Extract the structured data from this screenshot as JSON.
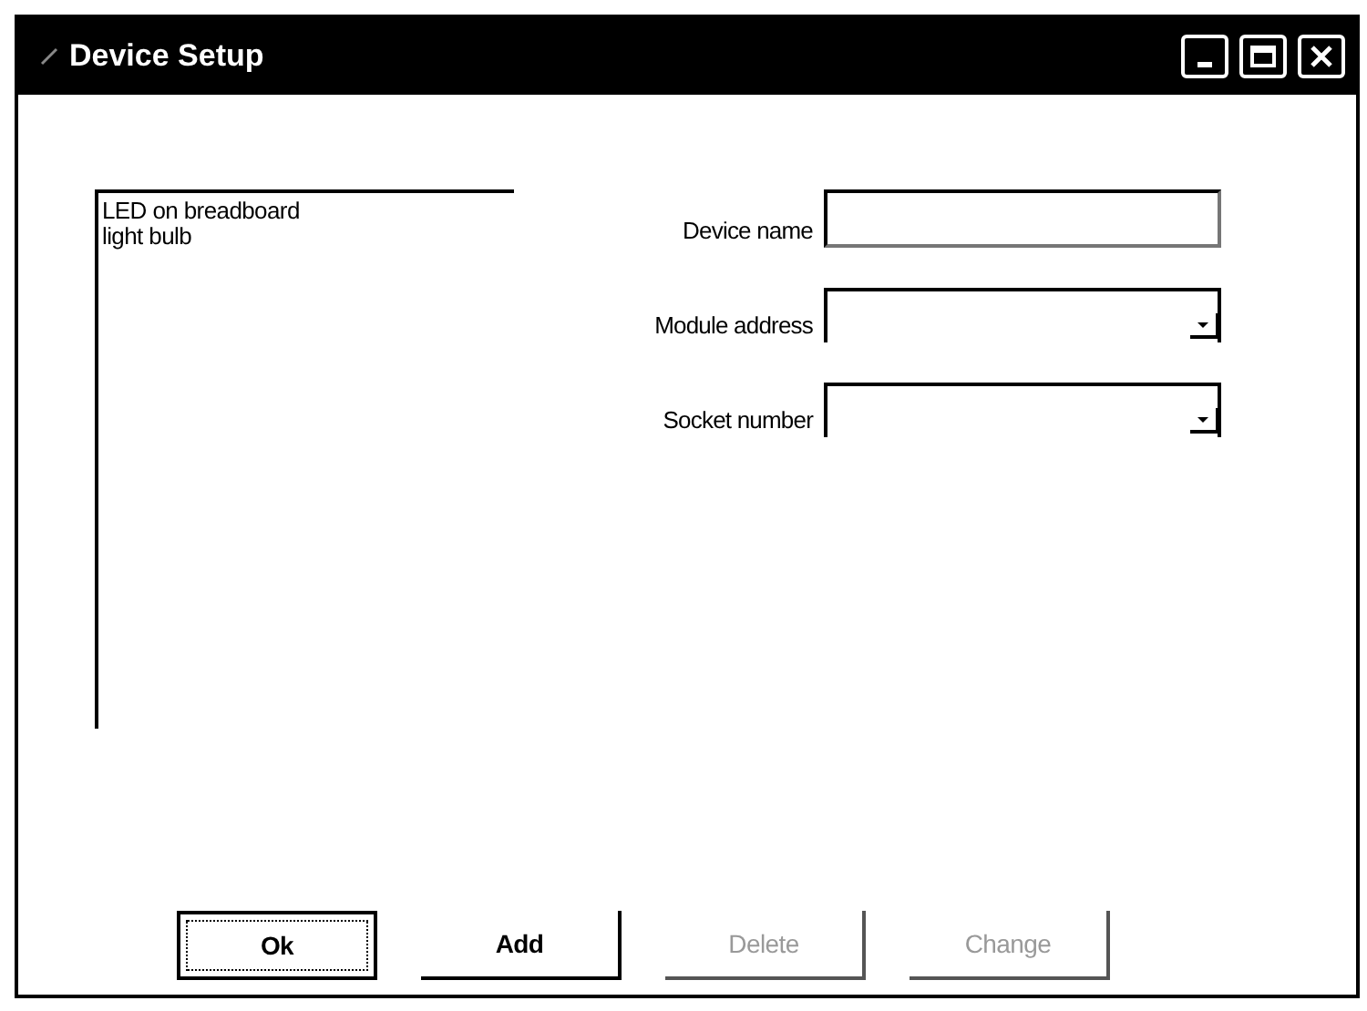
{
  "window": {
    "title": "Device Setup"
  },
  "devices": [
    {
      "label": "LED on breadboard",
      "selected": false
    },
    {
      "label": "light bulb",
      "selected": false
    }
  ],
  "fields": [
    {
      "label": "Device name",
      "kind": "text"
    },
    {
      "label": "Module address",
      "kind": "dropdown"
    },
    {
      "label": "Socket number",
      "kind": "dropdown"
    }
  ],
  "buttons": [
    {
      "label": "Ok",
      "disabled": false,
      "default": true
    },
    {
      "label": "Add",
      "disabled": false,
      "default": false
    },
    {
      "label": "Delete",
      "disabled": true,
      "default": false
    },
    {
      "label": "Change",
      "disabled": true,
      "default": false
    }
  ]
}
